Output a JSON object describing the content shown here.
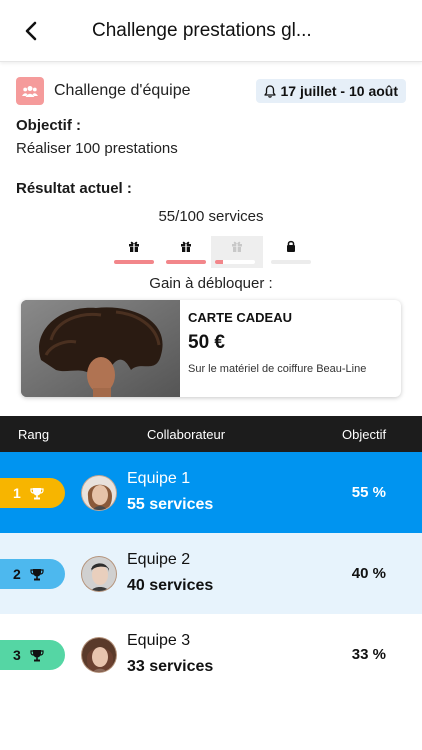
{
  "header": {
    "title": "Challenge prestations gl...",
    "back_icon": "chevron-left-icon"
  },
  "challenge": {
    "type_label": "Challenge d'équipe",
    "date_range": "17 juillet - 10 août",
    "objective_label": "Objectif :",
    "objective_text": "Réaliser 100 prestations",
    "result_label": "Résultat actuel :",
    "result_value": "55/100 services",
    "progress": 0.55,
    "steps": [
      {
        "icon": "gift-icon",
        "fill": 1.0,
        "active": false
      },
      {
        "icon": "gift-icon",
        "fill": 1.0,
        "active": false
      },
      {
        "icon": "gift-icon",
        "fill": 0.2,
        "active": true
      },
      {
        "icon": "lock-icon",
        "fill": 0.0,
        "active": false
      }
    ],
    "gain_label": "Gain à débloquer :"
  },
  "reward": {
    "title": "CARTE CADEAU",
    "amount": "50 €",
    "description": "Sur le matériel de coiffure Beau-Line"
  },
  "table": {
    "columns": {
      "rank": "Rang",
      "member": "Collaborateur",
      "objective": "Objectif"
    },
    "rows": [
      {
        "rank": "1",
        "name": "Equipe 1",
        "services": "55 services",
        "percent": "55 %"
      },
      {
        "rank": "2",
        "name": "Equipe 2",
        "services": "40 services",
        "percent": "40 %"
      },
      {
        "rank": "3",
        "name": "Equipe 3",
        "services": "33 services",
        "percent": "33 %"
      }
    ]
  },
  "colors": {
    "accent_pink": "#f59b9b",
    "row1_bg": "#0094f0",
    "row2_bg": "#e7f3fc",
    "row3_bg": "#ffffff",
    "rank1_pill": "#f7b500",
    "rank2_pill": "#4db8ee",
    "rank3_pill": "#55d6a4"
  }
}
